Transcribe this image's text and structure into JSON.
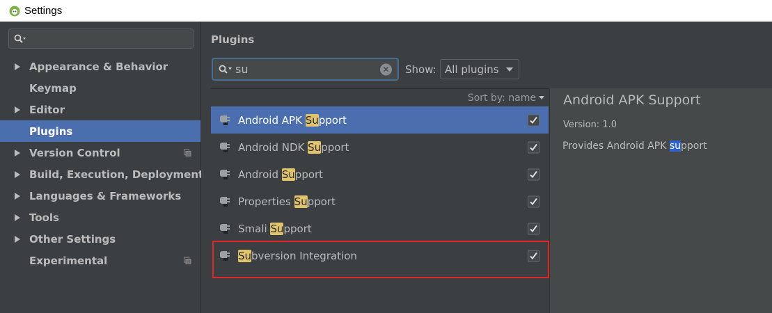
{
  "window": {
    "title": "Settings"
  },
  "sidebar": {
    "items": [
      {
        "label": "Appearance & Behavior",
        "expandable": true,
        "copy_icon": false
      },
      {
        "label": "Keymap",
        "expandable": false,
        "copy_icon": false
      },
      {
        "label": "Editor",
        "expandable": true,
        "copy_icon": false
      },
      {
        "label": "Plugins",
        "expandable": false,
        "copy_icon": false,
        "selected": true
      },
      {
        "label": "Version Control",
        "expandable": true,
        "copy_icon": true
      },
      {
        "label": "Build, Execution, Deployment",
        "expandable": true,
        "copy_icon": false
      },
      {
        "label": "Languages & Frameworks",
        "expandable": true,
        "copy_icon": false
      },
      {
        "label": "Tools",
        "expandable": true,
        "copy_icon": false
      },
      {
        "label": "Other Settings",
        "expandable": true,
        "copy_icon": false
      },
      {
        "label": "Experimental",
        "expandable": false,
        "copy_icon": true
      }
    ]
  },
  "plugins": {
    "section_title": "Plugins",
    "search_value": "su",
    "show_label": "Show:",
    "show_selected": "All plugins",
    "sort_label": "Sort by: name",
    "list": [
      {
        "pre": "Android APK ",
        "match": "Su",
        "post": "pport",
        "checked": true,
        "selected": true
      },
      {
        "pre": "Android NDK ",
        "match": "Su",
        "post": "pport",
        "checked": true,
        "selected": false
      },
      {
        "pre": "Android ",
        "match": "Su",
        "post": "pport",
        "checked": true,
        "selected": false
      },
      {
        "pre": "Properties ",
        "match": "Su",
        "post": "pport",
        "checked": true,
        "selected": false
      },
      {
        "pre": "Smali ",
        "match": "Su",
        "post": "pport",
        "checked": true,
        "selected": false
      },
      {
        "pre": "",
        "match": "Su",
        "post": "bversion Integration",
        "checked": true,
        "selected": false
      }
    ]
  },
  "detail": {
    "title": "Android APK Support",
    "version": "Version: 1.0",
    "desc_pre": "Provides Android APK ",
    "desc_match": "su",
    "desc_post": "pport"
  },
  "colors": {
    "selection": "#4b6eaf",
    "match_highlight": "#e0c46c",
    "detail_match": "#2f65ca",
    "annotation": "#e02626"
  }
}
